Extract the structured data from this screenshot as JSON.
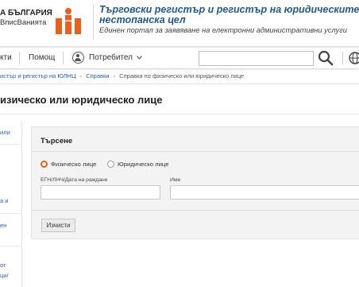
{
  "header": {
    "logo_line1": "А БЪЛГАРИЯ",
    "logo_line2": "ВписВанията",
    "title": "Търговски регистър и регистър на юридическите л нестопанска цел",
    "subtitle": "Единен портал за заявяване на електронни административни услуги",
    "brand_color": "#e8601c",
    "title_color": "#1c5a91"
  },
  "nav": {
    "item1": "кти",
    "item2": "Помощ",
    "user": "Потребител",
    "user_icon": "user-circle-icon",
    "search_placeholder": "",
    "search_icon": "search-icon",
    "language_icon": "globe-icon"
  },
  "breadcrumb": {
    "item1": "истър и регистър на ЮЛНЦ",
    "item2": "Справки",
    "current": "Справка по физическо или юридическо лице"
  },
  "page": {
    "title": "изическо или юридическо лице"
  },
  "sidebar": {
    "items": [
      "или",
      "а и",
      "ен",
      "от",
      "ци/"
    ]
  },
  "search_panel": {
    "title": "Търсене",
    "radio_physical": "Физическо лице",
    "radio_legal": "Юридическо лице",
    "selected": "Физическо лице",
    "egn_label": "ЕГН/ЛНЧ/Дата на раждане",
    "egn_value": "",
    "name_label": "Име",
    "name_value": "",
    "clear_button": "Изчисти"
  }
}
